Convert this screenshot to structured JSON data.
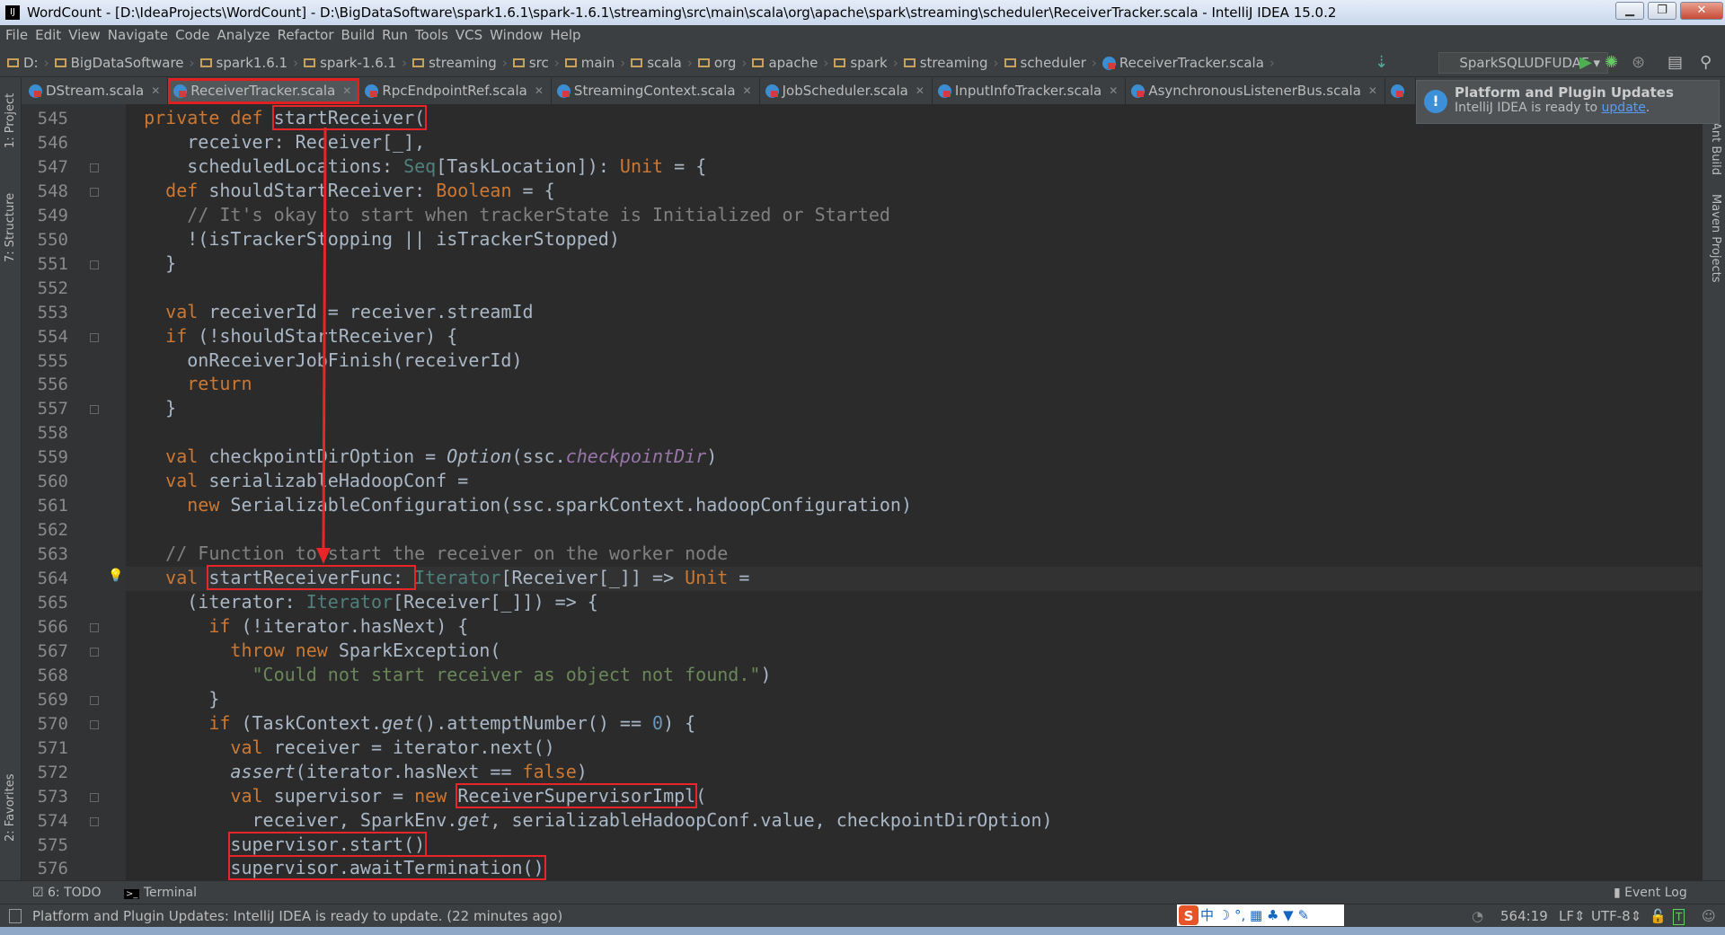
{
  "window": {
    "title": "WordCount - [D:\\IdeaProjects\\WordCount] - D:\\BigDataSoftware\\spark1.6.1\\spark-1.6.1\\streaming\\src\\main\\scala\\org\\apache\\spark\\streaming\\scheduler\\ReceiverTracker.scala - IntelliJ IDEA 15.0.2",
    "minimize": "▁",
    "restore": "❐",
    "close": "✕"
  },
  "menu": [
    "File",
    "Edit",
    "View",
    "Navigate",
    "Code",
    "Analyze",
    "Refactor",
    "Build",
    "Run",
    "Tools",
    "VCS",
    "Window",
    "Help"
  ],
  "breadcrumbs": [
    "D:",
    "BigDataSoftware",
    "spark1.6.1",
    "spark-1.6.1",
    "streaming",
    "src",
    "main",
    "scala",
    "org",
    "apache",
    "spark",
    "streaming",
    "scheduler",
    "ReceiverTracker.scala"
  ],
  "run_config": "SparkSQLUDFUDAF ▾",
  "tabs": [
    {
      "label": "DStream.scala",
      "active": false
    },
    {
      "label": "ReceiverTracker.scala",
      "active": true
    },
    {
      "label": "RpcEndpointRef.scala",
      "active": false
    },
    {
      "label": "StreamingContext.scala",
      "active": false
    },
    {
      "label": "JobScheduler.scala",
      "active": false
    },
    {
      "label": "InputInfoTracker.scala",
      "active": false
    },
    {
      "label": "AsynchronousListenerBus.scala",
      "active": false
    }
  ],
  "left_tools": [
    "1: Project",
    "7: Structure",
    "2: Favorites"
  ],
  "right_tools": [
    "Ant Build",
    "Maven Projects"
  ],
  "notification": {
    "title": "Platform and Plugin Updates",
    "text": "IntelliJ IDEA is ready to ",
    "link": "update",
    "tail": "."
  },
  "editor": {
    "current_line": 564,
    "lines": [
      {
        "n": 545,
        "t": [
          [
            "  "
          ],
          [
            "private def ",
            "k"
          ],
          [
            "startReceiver(",
            "box"
          ]
        ]
      },
      {
        "n": 546,
        "t": [
          [
            "      receiver: Receiver[_],"
          ]
        ]
      },
      {
        "n": 547,
        "t": [
          [
            "      scheduledLocations: "
          ],
          [
            "Seq",
            "t"
          ],
          [
            "[TaskLocation]): "
          ],
          [
            "Unit",
            "k"
          ],
          [
            " = {"
          ]
        ]
      },
      {
        "n": 548,
        "t": [
          [
            "    "
          ],
          [
            "def ",
            "k"
          ],
          [
            "shouldStartReceiver: "
          ],
          [
            "Boolean",
            "k"
          ],
          [
            " = {"
          ]
        ]
      },
      {
        "n": 549,
        "t": [
          [
            "      "
          ],
          [
            "// It's okay to start when trackerState is Initialized or Started",
            "c"
          ]
        ]
      },
      {
        "n": 550,
        "t": [
          [
            "      !(isTrackerStopping || isTrackerStopped)"
          ]
        ]
      },
      {
        "n": 551,
        "t": [
          [
            "    }"
          ]
        ]
      },
      {
        "n": 552,
        "t": [
          [
            ""
          ]
        ]
      },
      {
        "n": 553,
        "t": [
          [
            "    "
          ],
          [
            "val ",
            "k"
          ],
          [
            "receiverId = receiver.streamId"
          ]
        ]
      },
      {
        "n": 554,
        "t": [
          [
            "    "
          ],
          [
            "if ",
            "k"
          ],
          [
            "(!shouldStartReceiver) {"
          ]
        ]
      },
      {
        "n": 555,
        "t": [
          [
            "      onReceiverJobFinish(receiverId)"
          ]
        ]
      },
      {
        "n": 556,
        "t": [
          [
            "      "
          ],
          [
            "return",
            "k"
          ]
        ]
      },
      {
        "n": 557,
        "t": [
          [
            "    }"
          ]
        ]
      },
      {
        "n": 558,
        "t": [
          [
            ""
          ]
        ]
      },
      {
        "n": 559,
        "t": [
          [
            "    "
          ],
          [
            "val ",
            "k"
          ],
          [
            "checkpointDirOption = "
          ],
          [
            "Option",
            "i"
          ],
          [
            "(ssc."
          ],
          [
            "checkpointDir",
            "p"
          ],
          [
            ")"
          ]
        ]
      },
      {
        "n": 560,
        "t": [
          [
            "    "
          ],
          [
            "val ",
            "k"
          ],
          [
            "serializableHadoopConf ="
          ]
        ]
      },
      {
        "n": 561,
        "t": [
          [
            "      "
          ],
          [
            "new ",
            "k"
          ],
          [
            "SerializableConfiguration(ssc.sparkContext.hadoopConfiguration)"
          ]
        ]
      },
      {
        "n": 562,
        "t": [
          [
            ""
          ]
        ]
      },
      {
        "n": 563,
        "t": [
          [
            "    "
          ],
          [
            "// Function to start the receiver on the worker node",
            "c"
          ]
        ]
      },
      {
        "n": 564,
        "t": [
          [
            "    "
          ],
          [
            "val ",
            "k"
          ],
          [
            "startReceiverFunc: ",
            "box"
          ],
          [
            "Iterator",
            "t"
          ],
          [
            "[Receiver[_]] => "
          ],
          [
            "Unit",
            "k"
          ],
          [
            " ="
          ]
        ]
      },
      {
        "n": 565,
        "t": [
          [
            "      (iterator: "
          ],
          [
            "Iterator",
            "t"
          ],
          [
            "[Receiver[_]]) => {"
          ]
        ]
      },
      {
        "n": 566,
        "t": [
          [
            "        "
          ],
          [
            "if ",
            "k"
          ],
          [
            "(!iterator.hasNext) {"
          ]
        ]
      },
      {
        "n": 567,
        "t": [
          [
            "          "
          ],
          [
            "throw new ",
            "k"
          ],
          [
            "SparkException("
          ]
        ]
      },
      {
        "n": 568,
        "t": [
          [
            "            "
          ],
          [
            "\"Could not start receiver as object not found.\"",
            "s"
          ],
          [
            ")"
          ]
        ]
      },
      {
        "n": 569,
        "t": [
          [
            "        }"
          ]
        ]
      },
      {
        "n": 570,
        "t": [
          [
            "        "
          ],
          [
            "if ",
            "k"
          ],
          [
            "(TaskContext."
          ],
          [
            "get",
            "i"
          ],
          [
            "().attemptNumber() == "
          ],
          [
            "0",
            "n"
          ],
          [
            ") {"
          ]
        ]
      },
      {
        "n": 571,
        "t": [
          [
            "          "
          ],
          [
            "val ",
            "k"
          ],
          [
            "receiver = iterator.next()"
          ]
        ]
      },
      {
        "n": 572,
        "t": [
          [
            "          "
          ],
          [
            "assert",
            "i"
          ],
          [
            "(iterator.hasNext == "
          ],
          [
            "false",
            "k"
          ],
          [
            ")"
          ]
        ]
      },
      {
        "n": 573,
        "t": [
          [
            "          "
          ],
          [
            "val ",
            "k"
          ],
          [
            "supervisor = "
          ],
          [
            "new ",
            "k"
          ],
          [
            "ReceiverSupervisorImpl",
            "box"
          ],
          [
            "("
          ]
        ]
      },
      {
        "n": 574,
        "t": [
          [
            "            receiver, SparkEnv."
          ],
          [
            "get",
            "i"
          ],
          [
            ", serializableHadoopConf.value, checkpointDirOption)"
          ]
        ]
      },
      {
        "n": 575,
        "t": [
          [
            "          "
          ],
          [
            "supervisor.start()",
            "box"
          ]
        ]
      },
      {
        "n": 576,
        "t": [
          [
            "          "
          ],
          [
            "supervisor.awaitTermination()",
            "box"
          ]
        ]
      }
    ]
  },
  "bottom_tools": {
    "todo": "6: TODO",
    "terminal": "Terminal",
    "event_log": "Event Log"
  },
  "status": {
    "message": "Platform and Plugin Updates: IntelliJ IDEA is ready to update. (22 minutes ago)",
    "position": "564:19",
    "line_sep": "LF⇕",
    "encoding": "UTF-8⇕",
    "ime": "中 ☽ °, ▦ ♣ ▼ ✎"
  },
  "colors": {
    "keyword": "#cc7832",
    "comment": "#808080",
    "string": "#6a8759",
    "annotation_red": "#e8262a",
    "editor_bg": "#2b2b2b"
  }
}
